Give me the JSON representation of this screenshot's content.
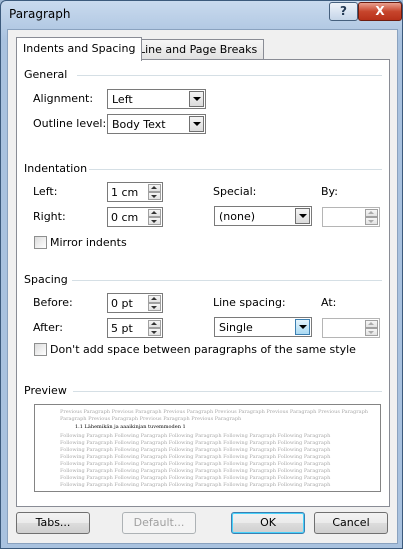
{
  "window": {
    "title": "Paragraph",
    "help_label": "?",
    "close_label": "X"
  },
  "tabs": [
    {
      "label": "Indents and Spacing",
      "active": true
    },
    {
      "label": "Line and Page Breaks",
      "active": false
    }
  ],
  "general": {
    "heading": "General",
    "alignment_label": "Alignment:",
    "alignment_value": "Left",
    "outline_label": "Outline level:",
    "outline_value": "Body Text"
  },
  "indentation": {
    "heading": "Indentation",
    "left_label": "Left:",
    "left_value": "1 cm",
    "right_label": "Right:",
    "right_value": "0 cm",
    "special_label": "Special:",
    "special_value": "(none)",
    "by_label": "By:",
    "by_value": "",
    "mirror_label": "Mirror indents",
    "mirror_checked": false
  },
  "spacing": {
    "heading": "Spacing",
    "before_label": "Before:",
    "before_value": "0 pt",
    "after_label": "After:",
    "after_value": "5 pt",
    "line_spacing_label": "Line spacing:",
    "line_spacing_value": "Single",
    "at_label": "At:",
    "at_value": "",
    "dont_add_label": "Don't add space between paragraphs of the same style",
    "dont_add_checked": false
  },
  "preview": {
    "heading": "Preview",
    "previous_lines": [
      "Previous Paragraph Previous Paragraph Previous Paragraph Previous Paragraph Previous Paragraph Previous Paragraph",
      "Paragraph Previous Paragraph Previous Paragraph Previous Paragraph"
    ],
    "sample_line": "1.1      Lähemikän ja aaaikinjan tuvemmoden      1",
    "following_lines": [
      "Following Paragraph Following Paragraph Following Paragraph Following Paragraph Following Paragraph",
      "Following Paragraph Following Paragraph Following Paragraph Following Paragraph Following Paragraph",
      "Following Paragraph Following Paragraph Following Paragraph Following Paragraph Following Paragraph",
      "Following Paragraph Following Paragraph Following Paragraph Following Paragraph Following Paragraph",
      "Following Paragraph Following Paragraph Following Paragraph Following Paragraph Following Paragraph",
      "Following Paragraph Following Paragraph Following Paragraph Following Paragraph Following Paragraph",
      "Following Paragraph Following Paragraph Following Paragraph Following Paragraph Following Paragraph",
      "Following Paragraph Following Paragraph Following Paragraph Following Paragraph Following Paragraph",
      "Following Paragraph Following Paragraph"
    ]
  },
  "buttons": {
    "tabs_label": "Tabs...",
    "default_label": "Default...",
    "ok_label": "OK",
    "cancel_label": "Cancel"
  }
}
